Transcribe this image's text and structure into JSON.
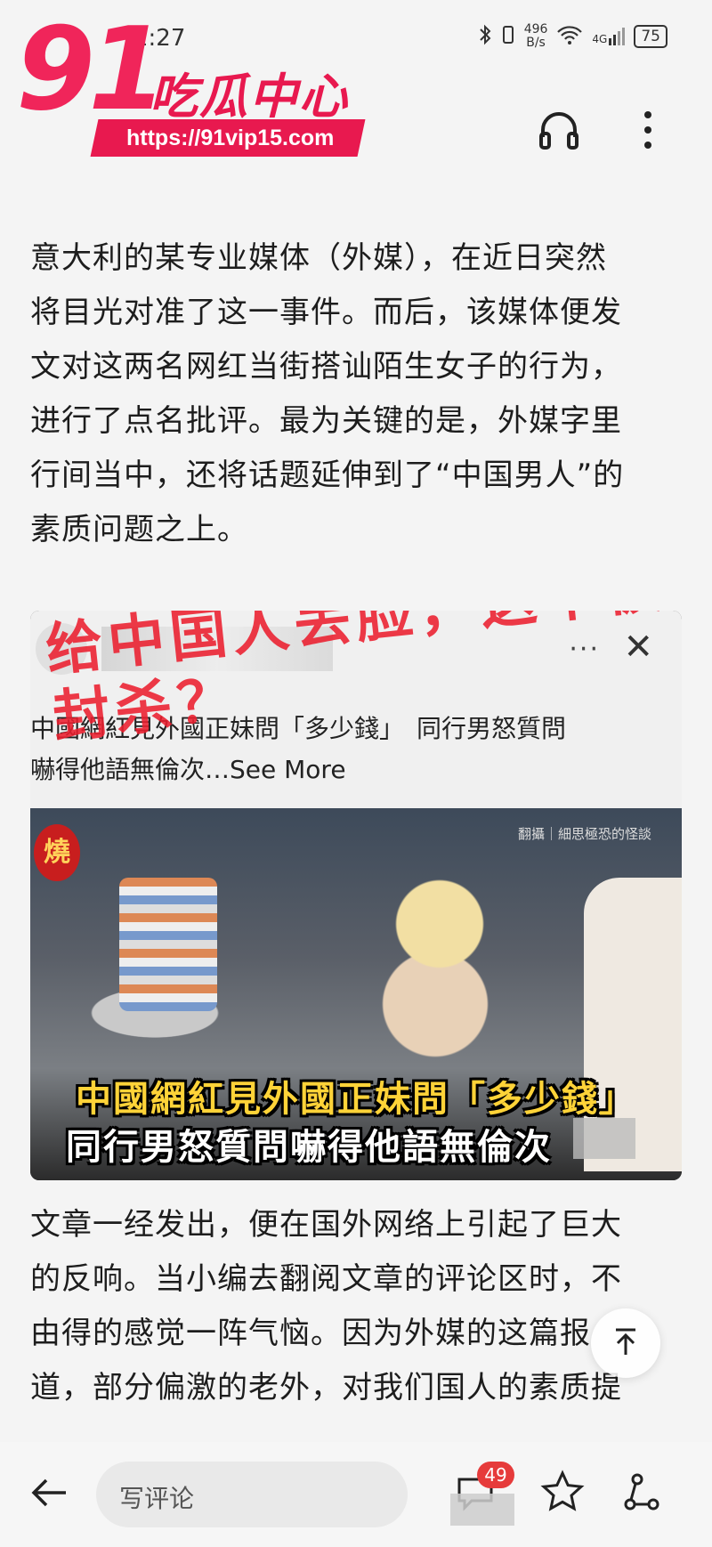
{
  "status_bar": {
    "time": "2:27",
    "net_speed": "496",
    "net_unit": "B/s",
    "network": "4G",
    "battery": "75"
  },
  "watermark": {
    "number": "91",
    "name": "吃瓜中心",
    "url": "https://91vip15.com"
  },
  "header": {
    "audio_icon": "headphones-icon",
    "more_icon": "more-vertical-icon"
  },
  "article": {
    "para1_lines": [
      "意大利的某专业媒体（外媒），在近日突然",
      "将目光对准了这一事件。而后，该媒体便发",
      "文对这两名网红当街搭讪陌生女子的行为，",
      "进行了点名批评。最为关键的是，外媒字里",
      "行间当中，还将话题延伸到了“中国男人”的",
      "素质问题之上。"
    ],
    "para2_lines": [
      "文章一经发出，便在国外网络上引起了巨大",
      "的反响。当小编去翻阅文章的评论区时，不",
      "由得的感觉一阵气恼。因为外媒的这篇报",
      "道，部分偏激的老外，对我们国人的素质提"
    ]
  },
  "embedded_post": {
    "red_overlay": "给中国人丢脸，这不被封杀？",
    "caption_line1": "中國網紅見外國正妹問「多少錢」　同行男怒質問",
    "caption_line2": "嚇得他語無倫次…See More",
    "menu": "···",
    "close": "✕",
    "badge": "燒",
    "video_tag": "翻攝｜細思極恐的怪談",
    "subtitle1": "中國網紅見外國正妹問「多少錢」",
    "subtitle2": "同行男怒質問嚇得他語無倫次"
  },
  "bottom_bar": {
    "comment_placeholder": "写评论",
    "comment_count": "49"
  }
}
